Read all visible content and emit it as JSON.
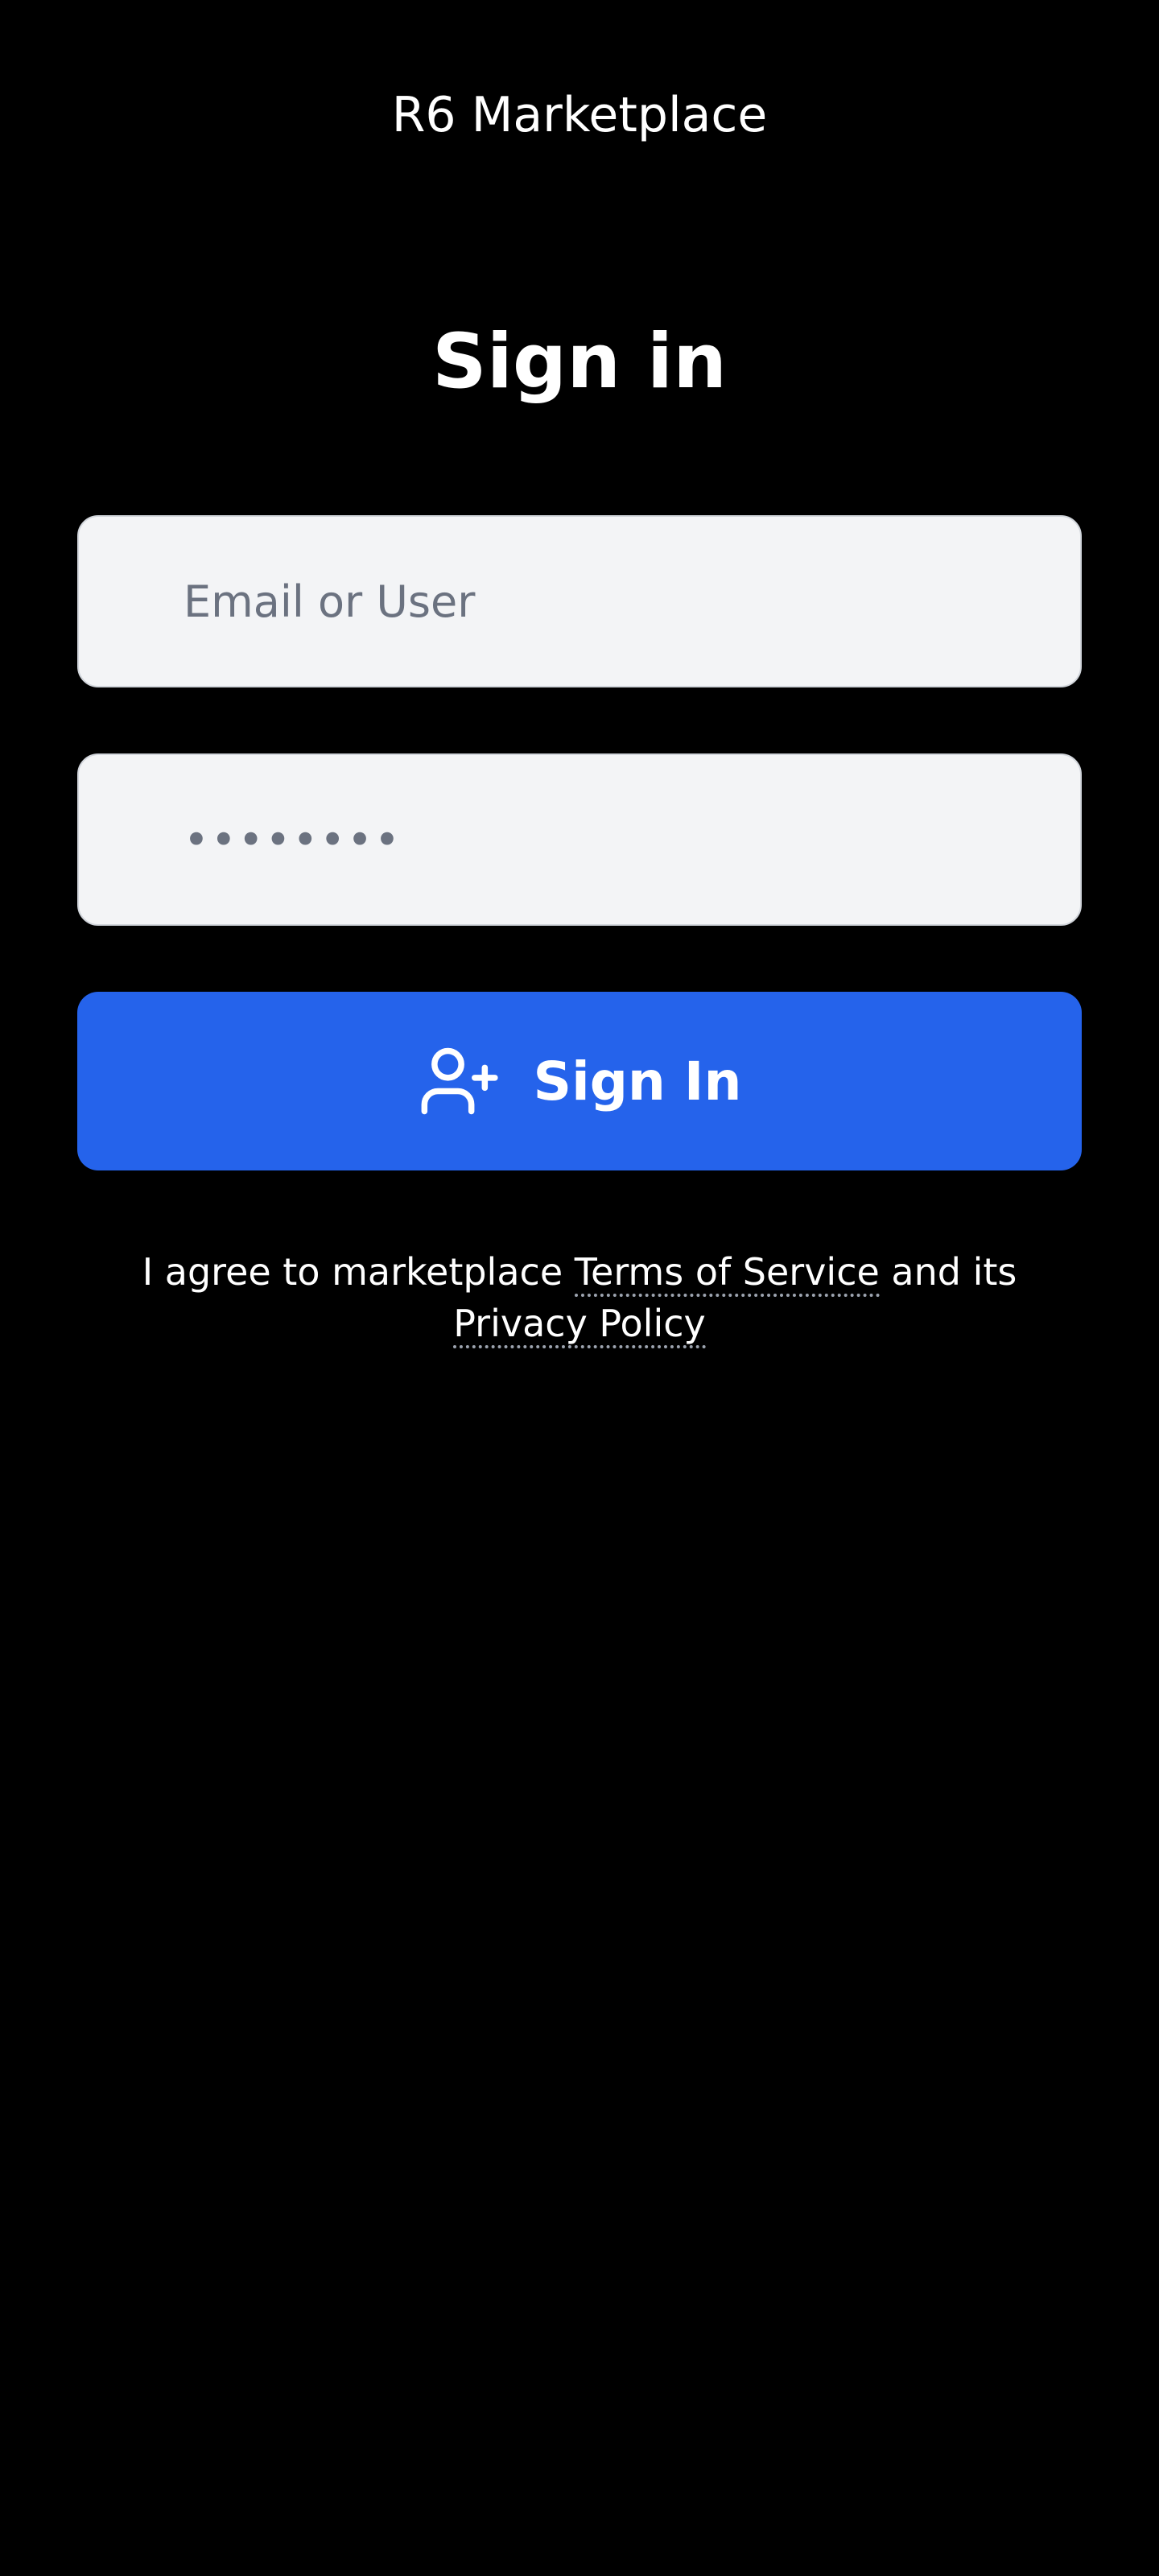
{
  "app": {
    "title": "R6 Marketplace"
  },
  "page": {
    "heading": "Sign in"
  },
  "form": {
    "email_placeholder": "Email or User",
    "email_value": "",
    "password_masked": "••••••••"
  },
  "signin_button": {
    "label": "Sign In",
    "icon": "user-plus-icon"
  },
  "terms": {
    "prefix": "I agree to marketplace ",
    "tos_link": "Terms of Service",
    "middle": " and its ",
    "privacy_link": "Privacy Policy"
  },
  "colors": {
    "background": "#000000",
    "input_background": "#f3f4f6",
    "placeholder": "#6b7280",
    "primary": "#2563eb",
    "text": "#ffffff"
  }
}
